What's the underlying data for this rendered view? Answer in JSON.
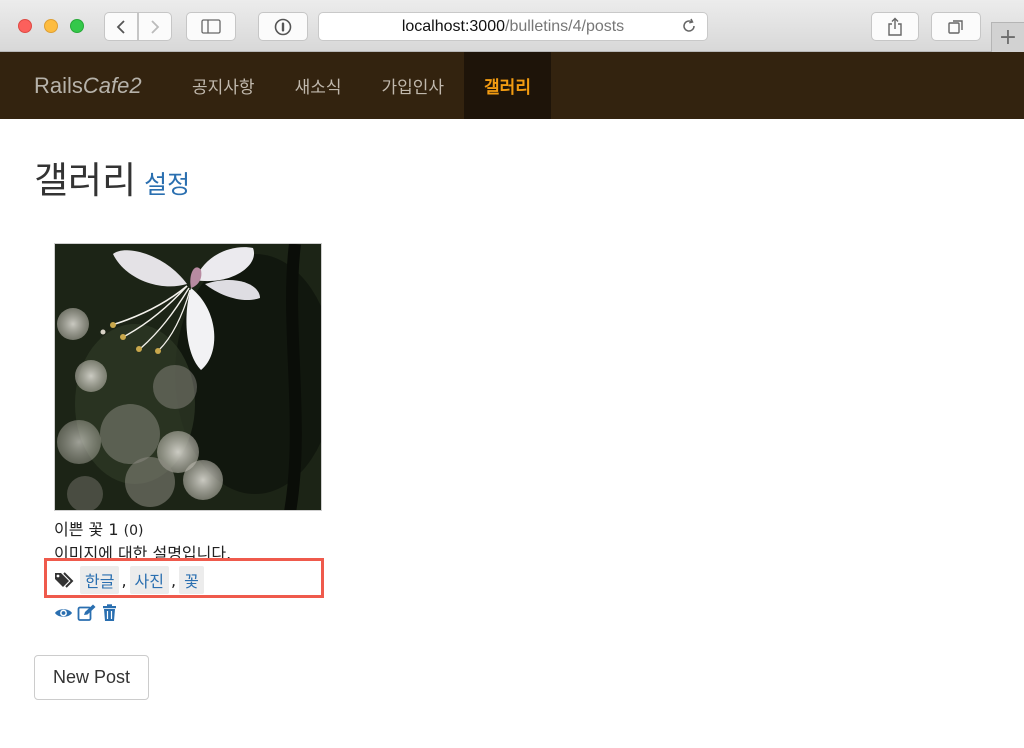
{
  "browser": {
    "url_host": "localhost:3000",
    "url_path": "/bulletins/4/posts",
    "reload_icon": "reload-icon",
    "newtab_symbol": "+"
  },
  "navbar": {
    "brand_main": "Rails",
    "brand_italic": "Cafe2",
    "items": [
      {
        "label": "공지사항"
      },
      {
        "label": "새소식"
      },
      {
        "label": "가입인사"
      },
      {
        "label": "갤러리"
      }
    ],
    "active_color": "#f39c12",
    "background": "#33230f"
  },
  "page": {
    "title": "갤러리",
    "settings_link": "설정"
  },
  "post": {
    "title": "이쁜 꽃 1",
    "comment_count": "(0)",
    "description": "이미지에 대한 설명입니다.",
    "tags": [
      "한글",
      "사진",
      "꽃"
    ],
    "tag_separator": ","
  },
  "actions": {
    "new_post": "New Post"
  },
  "colors": {
    "link": "#2a6fb0",
    "highlight_box": "#ef5a4c"
  }
}
